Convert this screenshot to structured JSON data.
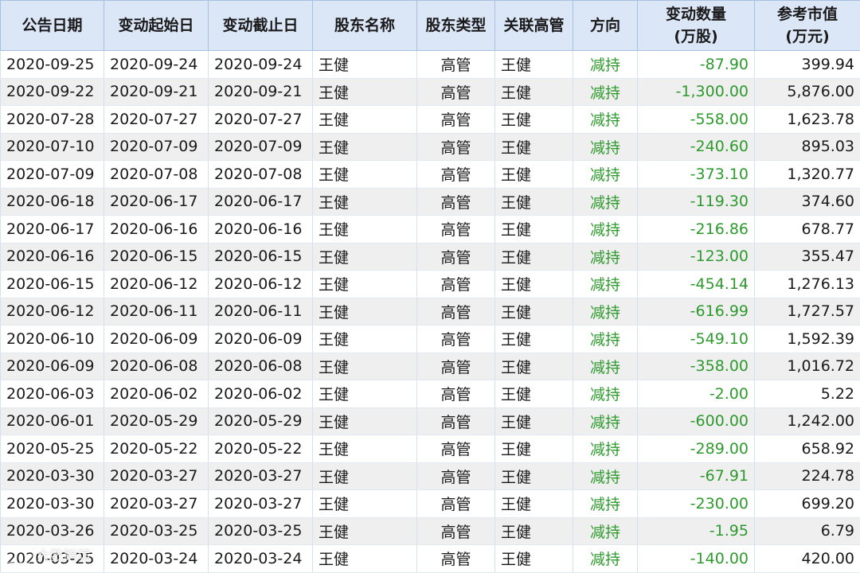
{
  "columns": [
    "公告日期",
    "变动起始日",
    "变动截止日",
    "股东名称",
    "股东类型",
    "关联高管",
    "方向",
    "变动数量\n(万股)",
    "参考市值\n(万元)"
  ],
  "rows": [
    [
      "2020-09-25",
      "2020-09-24",
      "2020-09-24",
      "王健",
      "高管",
      "王健",
      "减持",
      "-87.90",
      "399.94"
    ],
    [
      "2020-09-22",
      "2020-09-21",
      "2020-09-21",
      "王健",
      "高管",
      "王健",
      "减持",
      "-1,300.00",
      "5,876.00"
    ],
    [
      "2020-07-28",
      "2020-07-27",
      "2020-07-27",
      "王健",
      "高管",
      "王健",
      "减持",
      "-558.00",
      "1,623.78"
    ],
    [
      "2020-07-10",
      "2020-07-09",
      "2020-07-09",
      "王健",
      "高管",
      "王健",
      "减持",
      "-240.60",
      "895.03"
    ],
    [
      "2020-07-09",
      "2020-07-08",
      "2020-07-08",
      "王健",
      "高管",
      "王健",
      "减持",
      "-373.10",
      "1,320.77"
    ],
    [
      "2020-06-18",
      "2020-06-17",
      "2020-06-17",
      "王健",
      "高管",
      "王健",
      "减持",
      "-119.30",
      "374.60"
    ],
    [
      "2020-06-17",
      "2020-06-16",
      "2020-06-16",
      "王健",
      "高管",
      "王健",
      "减持",
      "-216.86",
      "678.77"
    ],
    [
      "2020-06-16",
      "2020-06-15",
      "2020-06-15",
      "王健",
      "高管",
      "王健",
      "减持",
      "-123.00",
      "355.47"
    ],
    [
      "2020-06-15",
      "2020-06-12",
      "2020-06-12",
      "王健",
      "高管",
      "王健",
      "减持",
      "-454.14",
      "1,276.13"
    ],
    [
      "2020-06-12",
      "2020-06-11",
      "2020-06-11",
      "王健",
      "高管",
      "王健",
      "减持",
      "-616.99",
      "1,727.57"
    ],
    [
      "2020-06-10",
      "2020-06-09",
      "2020-06-09",
      "王健",
      "高管",
      "王健",
      "减持",
      "-549.10",
      "1,592.39"
    ],
    [
      "2020-06-09",
      "2020-06-08",
      "2020-06-08",
      "王健",
      "高管",
      "王健",
      "减持",
      "-358.00",
      "1,016.72"
    ],
    [
      "2020-06-03",
      "2020-06-02",
      "2020-06-02",
      "王健",
      "高管",
      "王健",
      "减持",
      "-2.00",
      "5.22"
    ],
    [
      "2020-06-01",
      "2020-05-29",
      "2020-05-29",
      "王健",
      "高管",
      "王健",
      "减持",
      "-600.00",
      "1,242.00"
    ],
    [
      "2020-05-25",
      "2020-05-22",
      "2020-05-22",
      "王健",
      "高管",
      "王健",
      "减持",
      "-289.00",
      "658.92"
    ],
    [
      "2020-03-30",
      "2020-03-27",
      "2020-03-27",
      "王健",
      "高管",
      "王健",
      "减持",
      "-67.91",
      "224.78"
    ],
    [
      "2020-03-30",
      "2020-03-27",
      "2020-03-27",
      "王健",
      "高管",
      "王健",
      "减持",
      "-230.00",
      "699.20"
    ],
    [
      "2020-03-26",
      "2020-03-25",
      "2020-03-25",
      "王健",
      "高管",
      "王健",
      "减持",
      "-1.95",
      "6.79"
    ],
    [
      "2020-03-25",
      "2020-03-24",
      "2020-03-24",
      "王健",
      "高管",
      "王健",
      "减持",
      "-140.00",
      "420.00"
    ]
  ],
  "colors": {
    "header_bg": "#dbe6f7",
    "direction_green": "#2e9a2e",
    "alt_row_bg": "#efefef"
  },
  "watermark": {
    "icon": "logo-icon",
    "text": "大数跨境"
  }
}
